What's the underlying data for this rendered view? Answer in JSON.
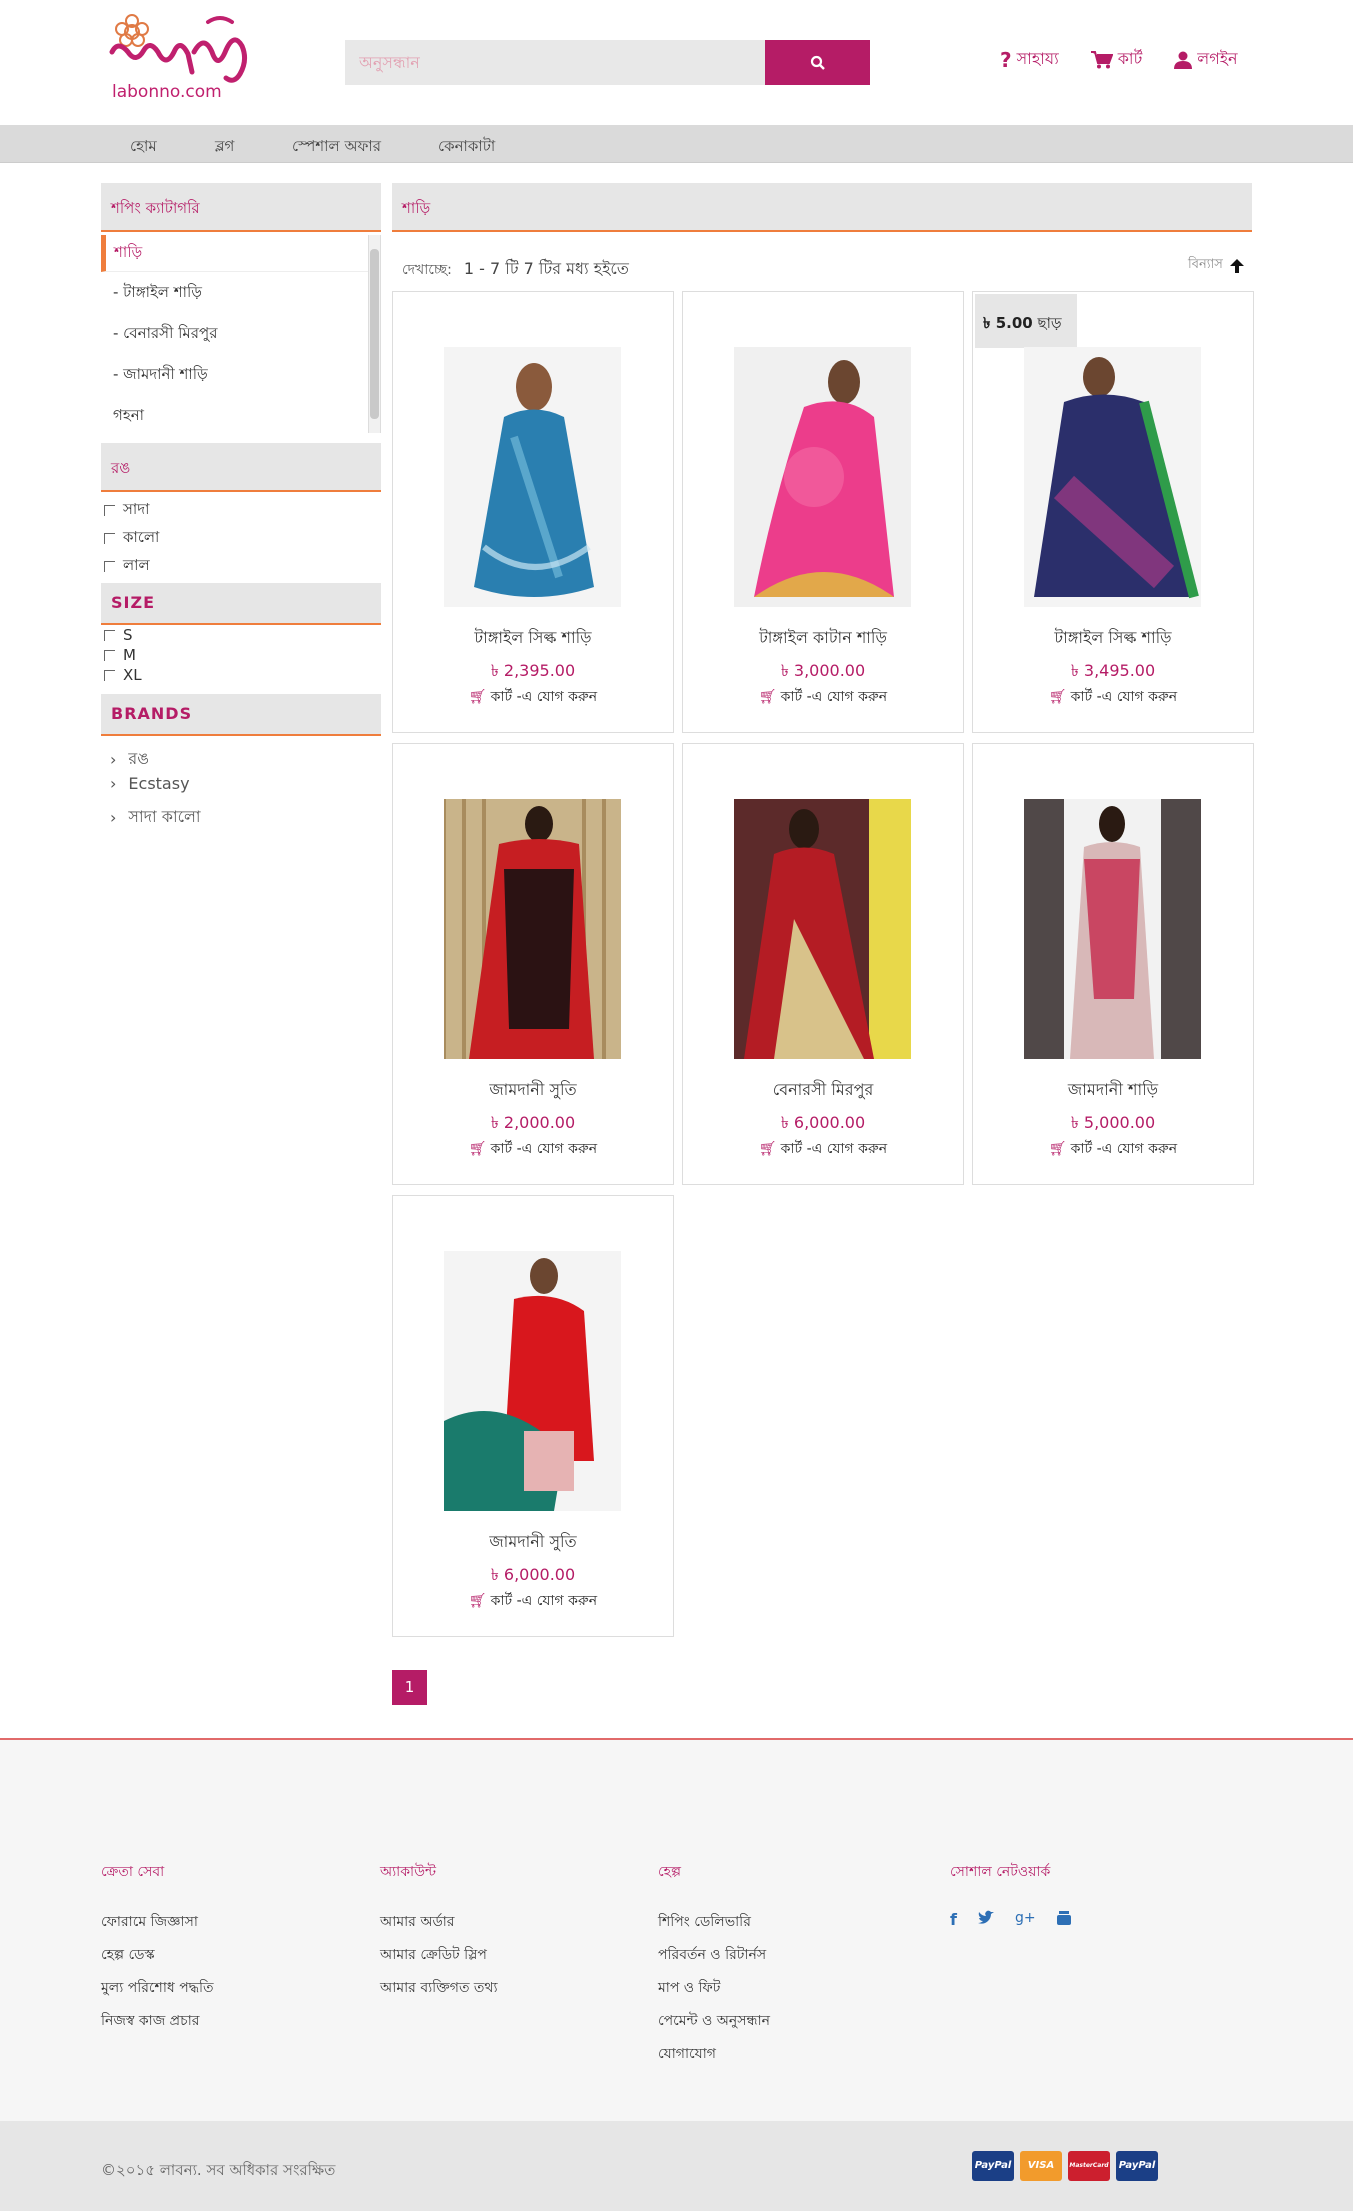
{
  "header": {
    "logo_text": "labonno.com",
    "search_placeholder": "অনুসন্ধান",
    "links": [
      {
        "icon": "question-icon",
        "label": "সাহায্য"
      },
      {
        "icon": "cart-icon",
        "label": "কার্ট"
      },
      {
        "icon": "user-icon",
        "label": "লগইন"
      }
    ]
  },
  "nav": [
    "হোম",
    "ব্লগ",
    "স্পেশাল অফার",
    "কেনাকাটা"
  ],
  "sidebar": {
    "category_title": "শপিং ক্যাটাগরি",
    "categories": [
      "শাড়ি",
      "- টাঙ্গাইল শাড়ি",
      "- বেনারসী মিরপুর",
      "- জামদানী শাড়ি",
      "গহনা"
    ],
    "color_title": "রঙ",
    "colors": [
      "সাদা",
      "কালো",
      "লাল"
    ],
    "size_title": "SIZE",
    "sizes": [
      "S",
      "M",
      "XL"
    ],
    "brands_title": "BRANDS",
    "brands": [
      "রঙ",
      "Ecstasy",
      "সাদা কালো"
    ]
  },
  "main": {
    "title": "শাড়ি",
    "showing_label": "দেখাচ্ছে:",
    "showing_value": "1 - 7 টি 7 টির মধ্য হইতে",
    "sort_label": "বিন্যাস",
    "add_to_cart": "কার্ট -এ যোগ করুন",
    "products": [
      {
        "title": "টাঙ্গাইল সিল্ক শাড়ি",
        "price": "৳ 2,395.00",
        "badge": ""
      },
      {
        "title": "টাঙ্গাইল কাটান শাড়ি",
        "price": "৳ 3,000.00",
        "badge": ""
      },
      {
        "title": "টাঙ্গাইল সিল্ক শাড়ি",
        "price": "৳ 3,495.00",
        "badge_amount": "৳ 5.00",
        "badge_text": "ছাড়"
      },
      {
        "title": "জামদানী সুতি",
        "price": "৳ 2,000.00",
        "badge": ""
      },
      {
        "title": "বেনারসী মিরপুর",
        "price": "৳ 6,000.00",
        "badge": ""
      },
      {
        "title": "জামদানী শাড়ি",
        "price": "৳ 5,000.00",
        "badge": ""
      },
      {
        "title": "জামদানী সুতি",
        "price": "৳ 6,000.00",
        "badge": ""
      }
    ],
    "page": "1"
  },
  "footer": {
    "columns": [
      {
        "title": "ক্রেতা সেবা",
        "links": [
          "ফোরামে জিজ্ঞাসা",
          "হেল্প ডেস্ক",
          "মুল্য পরিশোধ পদ্ধতি",
          "নিজস্ব কাজ প্রচার"
        ]
      },
      {
        "title": "অ্যাকাউন্ট",
        "links": [
          "আমার অর্ডার",
          "আমার ক্রেডিট স্লিপ",
          "আমার ব্যক্তিগত তথ্য"
        ]
      },
      {
        "title": "হেল্প",
        "links": [
          "শিপিং ডেলিভারি",
          "পরিবর্তন ও রিটার্নস",
          "মাপ ও ফিট",
          "পেমেন্ট ও অনুসন্ধান",
          "যোগাযোগ"
        ]
      },
      {
        "title": "সোশাল নেটওয়ার্ক",
        "icons": [
          "facebook-icon",
          "twitter-icon",
          "google-plus-icon",
          "youtube-icon"
        ]
      }
    ],
    "copyright": "©২০১৫ লাবন্য. সব অধিকার সংরক্ষিত",
    "payments": [
      "PayPal",
      "VISA",
      "MasterCard",
      "PayPal"
    ]
  },
  "colors": {
    "accent": "#b51c66",
    "underline": "#ef7d3c",
    "header_bg": "#e6e6e6"
  }
}
